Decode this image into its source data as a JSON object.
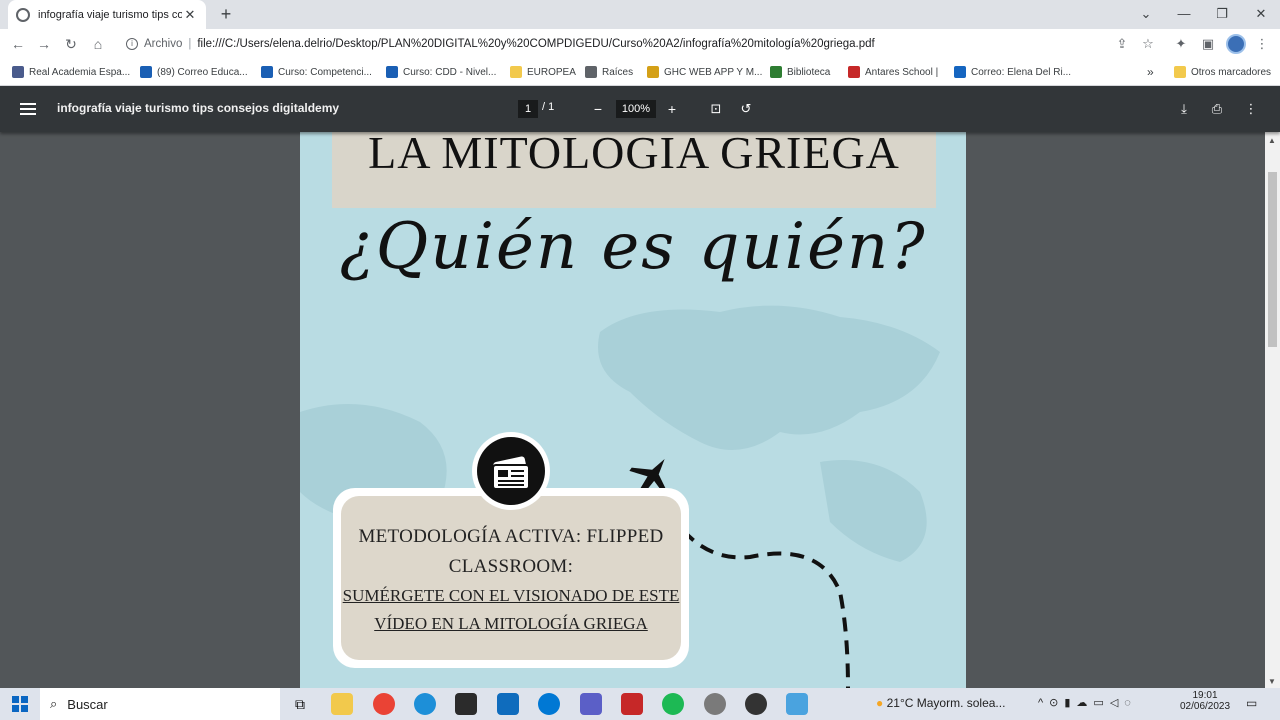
{
  "browser": {
    "tab_title": "infografía viaje turismo tips conse",
    "address_label": "Archivo",
    "address_url": "file:///C:/Users/elena.delrio/Desktop/PLAN%20DIGITAL%20y%20COMPDIGEDU/Curso%20A2/infografía%20mitología%20griega.pdf",
    "bookmarks": [
      {
        "label": "Real Academia Espa...",
        "color": "#4a5b8c"
      },
      {
        "label": "(89) Correo Educa...",
        "color": "#1a5fb4"
      },
      {
        "label": "Curso: Competenci...",
        "color": "#1a5fb4"
      },
      {
        "label": "Curso: CDD - Nivel...",
        "color": "#1a5fb4"
      },
      {
        "label": "EUROPEA",
        "color": "#f2c94c"
      },
      {
        "label": "Raíces",
        "color": "#5f6368"
      },
      {
        "label": "GHC WEB APP Y M...",
        "color": "#d4a017"
      },
      {
        "label": "Biblioteca",
        "color": "#2e7d32"
      },
      {
        "label": "Antares School |",
        "color": "#c62828"
      },
      {
        "label": "Correo: Elena Del Ri...",
        "color": "#1565c0"
      }
    ],
    "more_bookmarks": "»",
    "other_bookmarks": "Otros marcadores"
  },
  "pdf": {
    "title": "infografía viaje turismo tips consejos digitaldemy",
    "page_current": "1",
    "page_total": "/ 1",
    "zoom": "100%"
  },
  "content": {
    "heading": "LA MITOLOGIA GRIEGA",
    "script_heading": "¿Quién es quién?",
    "card_title": "METODOLOGÍA ACTIVA: FLIPPED CLASSROOM:",
    "card_link": "SUMÉRGETE CON EL VISIONADO DE ESTE VÍDEO EN LA MITOLOGÍA GRIEGA"
  },
  "taskbar": {
    "search_placeholder": "Buscar",
    "weather": "21°C  Mayorm. solea...",
    "time": "19:01",
    "date": "02/06/2023"
  }
}
